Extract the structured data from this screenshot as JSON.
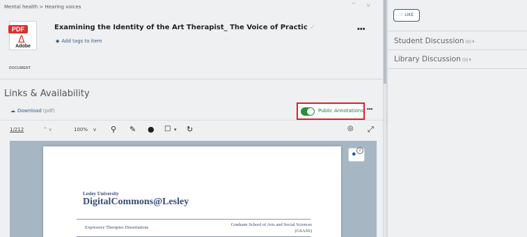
{
  "breadcrumb": "Mental health > Hearing voices",
  "nav_arrows": "^ v",
  "document": {
    "icon_tag": "PDF",
    "icon_brand": "Adobe",
    "type_label": "DOCUMENT",
    "title": "Examining the Identity of the Art Therapist_ The Voice of Practic",
    "title_check": "✓",
    "tags_link": "Add tags to item",
    "more": "•••"
  },
  "links": {
    "section_title": "Links & Availability",
    "download_label": "Download",
    "download_ext": "(pdf)",
    "public_annotations": "Public Annotations",
    "more": "•••"
  },
  "toolbar": {
    "page_indicator": "1/212",
    "page_arrows": "^ v",
    "zoom": "100%",
    "zoom_chevron": "v"
  },
  "pdf_page": {
    "university": "Lesley University",
    "repository": "DigitalCommons@Lesley",
    "series": "Expressive Therapies Dissertations",
    "school_line1": "Graduate School of Arts and Social Sciences",
    "school_line2": "(GSASS)"
  },
  "comment_count": "2",
  "sidebar": {
    "like_label": "LIKE",
    "student_discussion": "Student Discussion",
    "student_count": "(0)",
    "library_discussion": "Library Discussion",
    "library_count": "(0)",
    "chevron": "›"
  }
}
